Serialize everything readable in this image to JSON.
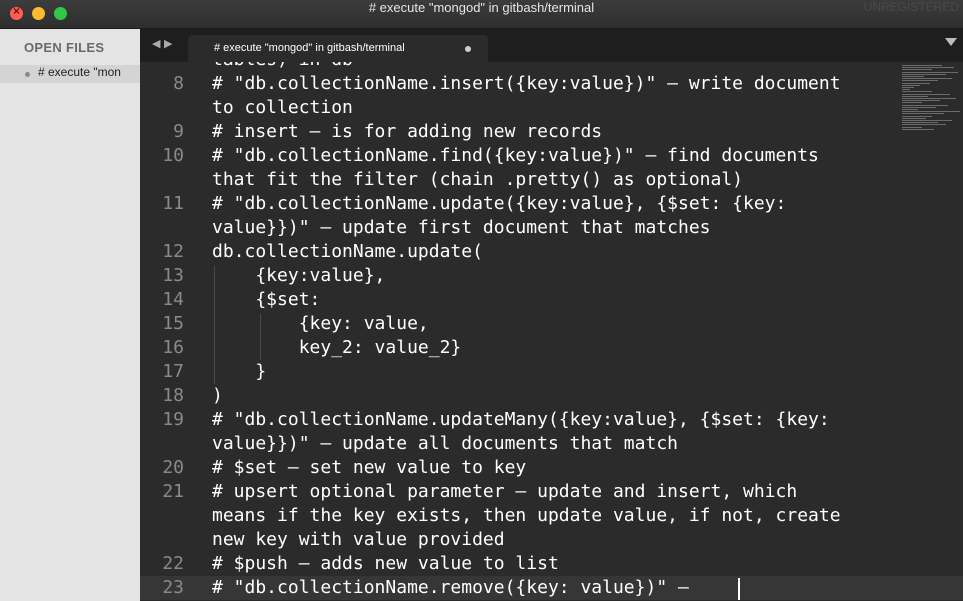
{
  "window": {
    "title": "# execute \"mongod\" in gitbash/terminal",
    "unregistered": "UNREGISTERED"
  },
  "sidebar": {
    "header": "OPEN FILES",
    "files": [
      {
        "label": "# execute \"mon"
      }
    ]
  },
  "tabbar": {
    "nav": "◀ ▶",
    "tab_title": "# execute \"mongod\" in gitbash/terminal"
  },
  "editor": {
    "lines": [
      {
        "num": "",
        "text": "tables) in db"
      },
      {
        "num": "8",
        "text": "# \"db.collectionName.insert({key:value})\" – write document"
      },
      {
        "num": "",
        "text": "to collection"
      },
      {
        "num": "9",
        "text": "# insert – is for adding new records"
      },
      {
        "num": "10",
        "text": "# \"db.collectionName.find({key:value})\" – find documents"
      },
      {
        "num": "",
        "text": "that fit the filter (chain .pretty() as optional)"
      },
      {
        "num": "11",
        "text": "# \"db.collectionName.update({key:value}, {$set: {key:"
      },
      {
        "num": "",
        "text": "value}})\" – update first document that matches"
      },
      {
        "num": "12",
        "text": "db.collectionName.update("
      },
      {
        "num": "13",
        "text": "    {key:value},"
      },
      {
        "num": "14",
        "text": "    {$set:"
      },
      {
        "num": "15",
        "text": "        {key: value,"
      },
      {
        "num": "16",
        "text": "        key_2: value_2}"
      },
      {
        "num": "17",
        "text": "    }"
      },
      {
        "num": "18",
        "text": ")"
      },
      {
        "num": "19",
        "text": "# \"db.collectionName.updateMany({key:value}, {$set: {key:"
      },
      {
        "num": "",
        "text": "value}})\" – update all documents that match"
      },
      {
        "num": "20",
        "text": "# $set – set new value to key"
      },
      {
        "num": "21",
        "text": "# upsert optional parameter – update and insert, which"
      },
      {
        "num": "",
        "text": "means if the key exists, then update value, if not, create"
      },
      {
        "num": "",
        "text": "new key with value provided"
      },
      {
        "num": "22",
        "text": "# $push – adds new value to list"
      },
      {
        "num": "23",
        "text": "# \"db.collectionName.remove({key: value})\" – "
      }
    ]
  }
}
